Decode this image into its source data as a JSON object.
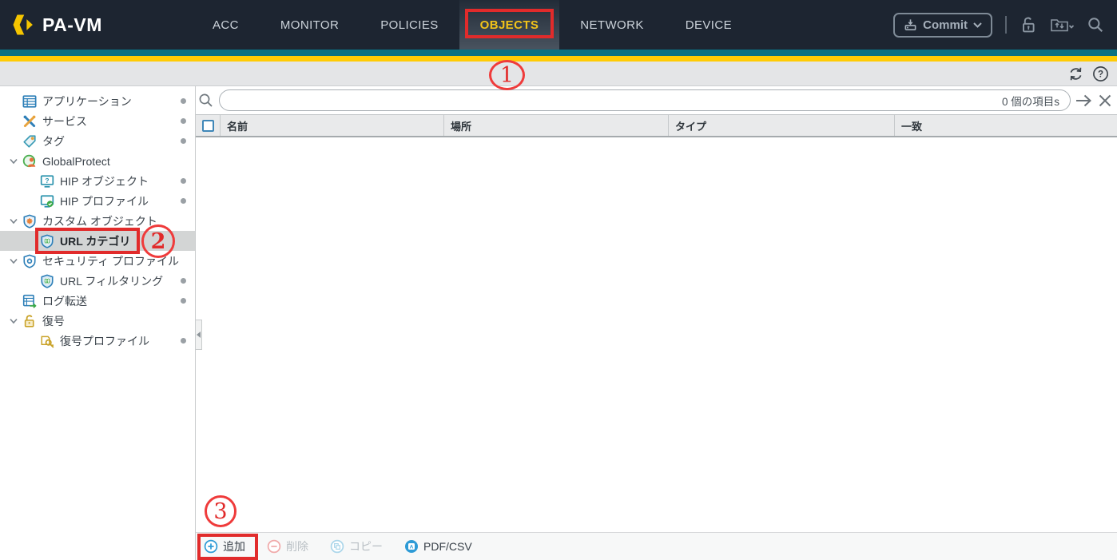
{
  "app": {
    "brand": "PA-VM"
  },
  "nav": {
    "tabs": [
      {
        "label": "ACC"
      },
      {
        "label": "MONITOR"
      },
      {
        "label": "POLICIES"
      },
      {
        "label": "OBJECTS"
      },
      {
        "label": "NETWORK"
      },
      {
        "label": "DEVICE"
      }
    ],
    "active_tab": "OBJECTS",
    "commit_label": "Commit"
  },
  "sidebar": {
    "items": [
      {
        "label": "アプリケーション"
      },
      {
        "label": "サービス"
      },
      {
        "label": "タグ"
      },
      {
        "label": "GlobalProtect",
        "expanded": true
      },
      {
        "label": "HIP オブジェクト",
        "child": true
      },
      {
        "label": "HIP プロファイル",
        "child": true
      },
      {
        "label": "カスタム オブジェクト",
        "expanded": true
      },
      {
        "label": "URL カテゴリ",
        "child": true,
        "selected": true
      },
      {
        "label": "セキュリティ プロファイル",
        "expanded": true
      },
      {
        "label": "URL フィルタリング",
        "child": true
      },
      {
        "label": "ログ転送"
      },
      {
        "label": "復号",
        "expanded": true
      },
      {
        "label": "復号プロファイル",
        "child": true
      }
    ]
  },
  "main": {
    "search": {
      "value": "",
      "count_label": "0 個の項目s"
    },
    "table": {
      "columns": [
        "名前",
        "場所",
        "タイプ",
        "一致"
      ],
      "rows": []
    },
    "footer": {
      "add_label": "追加",
      "delete_label": "削除",
      "copy_label": "コピー",
      "pdf_label": "PDF/CSV"
    }
  },
  "annotations": {
    "step1": "1",
    "step2": "2",
    "step3": "3"
  },
  "colors": {
    "header_bg": "#1d2531",
    "stripe_teal": "#0b7183",
    "accent_yellow": "#ffcb05",
    "active_tab_text": "#f2c319",
    "annotation_red": "#e12b2b",
    "icon_blue": "#2e9bd6"
  }
}
